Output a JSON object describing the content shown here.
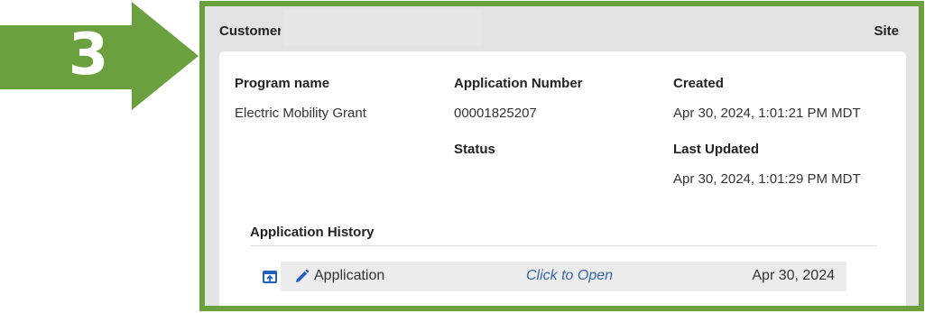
{
  "step": {
    "number": "3",
    "color": "#6ba03e"
  },
  "topbar": {
    "left_label": "Customer",
    "right_label": "Site"
  },
  "details": {
    "program_name_label": "Program name",
    "program_name_value": "Electric Mobility Grant",
    "application_number_label": "Application Number",
    "application_number_value": "00001825207",
    "status_label": "Status",
    "created_label": "Created",
    "created_value": "Apr 30, 2024, 1:01:21 PM MDT",
    "last_updated_label": "Last Updated",
    "last_updated_value": "Apr 30, 2024, 1:01:29 PM MDT"
  },
  "history": {
    "title": "Application History",
    "rows": [
      {
        "open_icon": "open-in-window-icon",
        "edit_icon": "pencil-icon",
        "name": "Application",
        "link": "Click to Open",
        "date": "Apr 30, 2024"
      }
    ]
  },
  "colors": {
    "accent_green": "#6ba03e",
    "link_blue": "#3566a8",
    "icon_blue": "#1f5fbf"
  }
}
